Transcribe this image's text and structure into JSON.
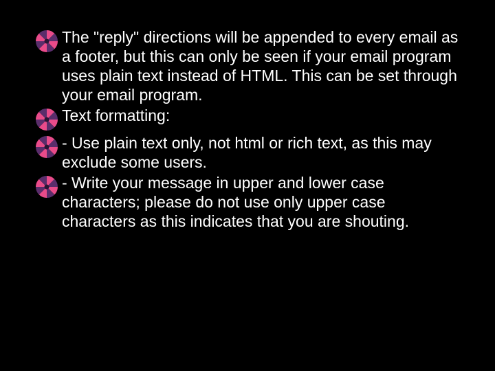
{
  "bullets": [
    {
      "text": "The \"reply\" directions will be appended to every email as a footer, but this can only be seen if your email program uses plain text instead of HTML. This can be set through your email program."
    },
    {
      "text": "Text formatting:"
    },
    {
      "text": "- Use plain text only, not html or rich text, as this may exclude some users."
    },
    {
      "text": "- Write your message in upper and lower case characters; please do not use only upper case characters as this indicates that you are shouting."
    }
  ]
}
